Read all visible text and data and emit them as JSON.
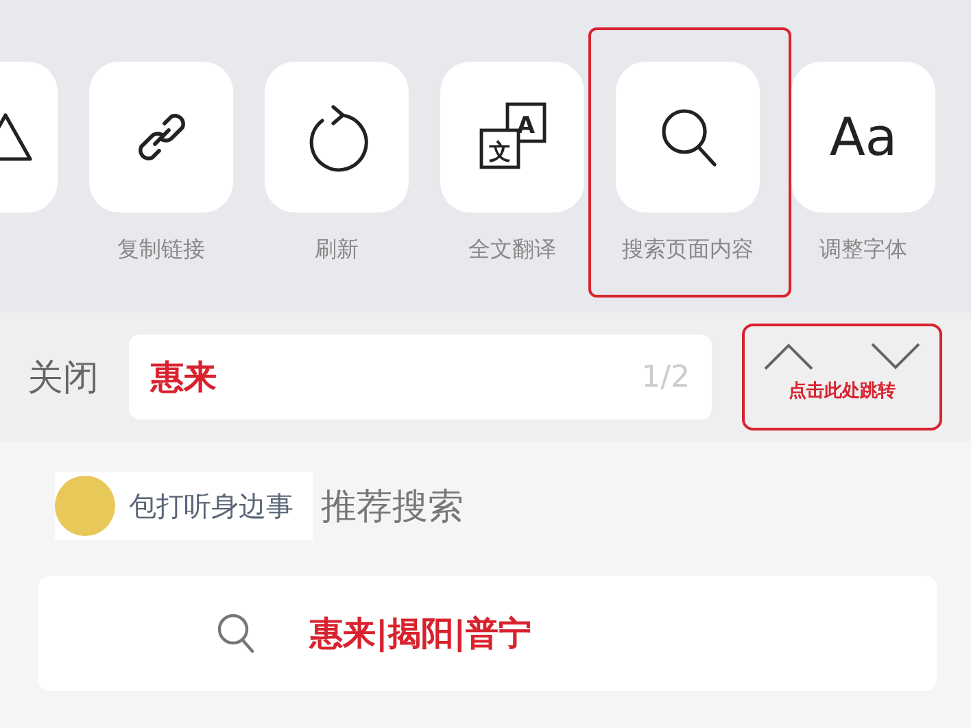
{
  "share_menu": {
    "items": [
      {
        "highlighted": false
      },
      {
        "label": "复制链接",
        "highlighted": false
      },
      {
        "label": "刷新",
        "highlighted": false
      },
      {
        "label": "全文翻译",
        "icon_text": [
          "A",
          "文"
        ],
        "highlighted": false
      },
      {
        "label": "搜索页面内容",
        "highlighted": true
      },
      {
        "label": "调整字体",
        "icon_text": [
          "Aa"
        ],
        "highlighted": false
      }
    ]
  },
  "find_bar": {
    "close": "关闭",
    "value": "惠来",
    "count": "1/2",
    "annotation": "点击此处跳转"
  },
  "recommend": {
    "account": "包打听身边事",
    "title": "推荐搜索",
    "query": "惠来|揭阳|普宁"
  }
}
